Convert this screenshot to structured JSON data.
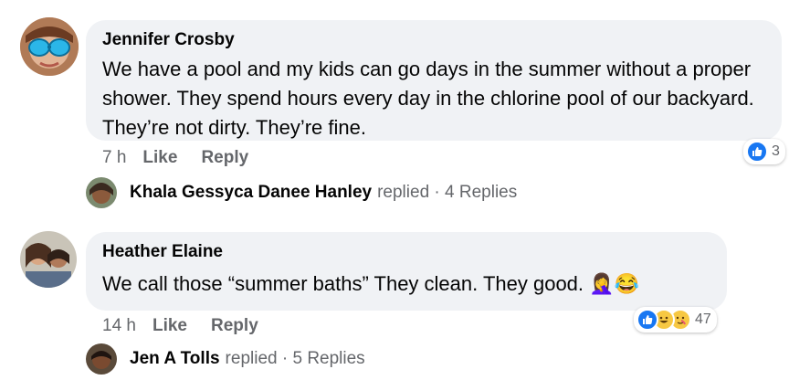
{
  "comments": [
    {
      "author": "Jennifer Crosby",
      "text": "We have a pool and my kids can go days in the summer without a proper shower. They spend hours every day in the chlorine pool of our backyard. They’re not dirty. They’re fine.",
      "time": "7 h",
      "like_label": "Like",
      "reply_label": "Reply",
      "reaction_count": "3",
      "reply_summary": {
        "name": "Khala Gessyca Danee Hanley",
        "rest": "replied · 4 Replies"
      }
    },
    {
      "author": "Heather Elaine",
      "text": "We call those “summer baths” They clean. They good. 🤦‍♀️😂",
      "time": "14 h",
      "like_label": "Like",
      "reply_label": "Reply",
      "reaction_count": "47",
      "reply_summary": {
        "name": "Jen A Tolls",
        "rest": "replied · 5 Replies"
      }
    }
  ],
  "colors": {
    "bubble": "#f0f2f5",
    "like_blue": "#1877f2",
    "meta_gray": "#65676b"
  }
}
